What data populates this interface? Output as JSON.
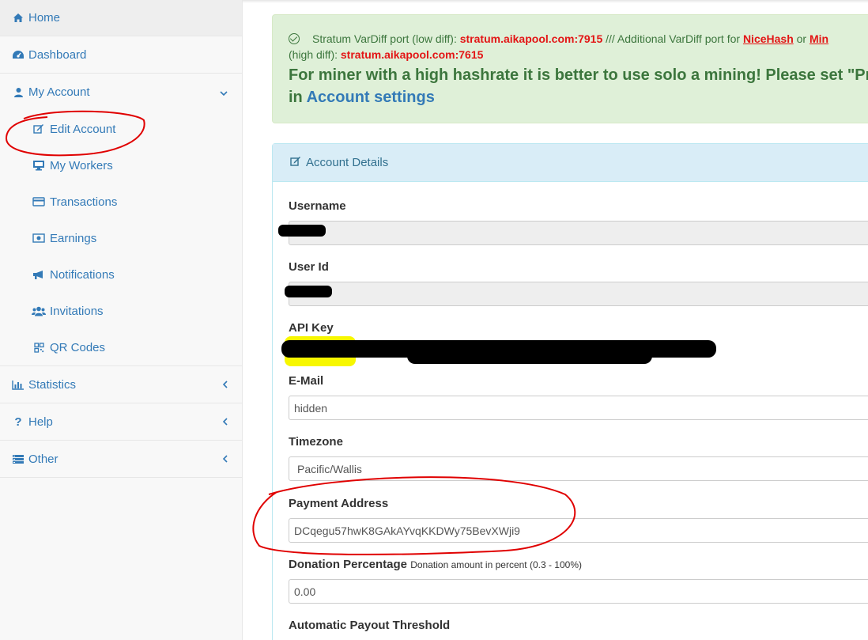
{
  "sidebar": {
    "home": "Home",
    "dashboard": "Dashboard",
    "my_account": "My Account",
    "sub_items": [
      "Edit Account",
      "My Workers",
      "Transactions",
      "Earnings",
      "Notifications",
      "Invitations",
      "QR Codes"
    ],
    "statistics": "Statistics",
    "help": "Help",
    "other": "Other"
  },
  "alert": {
    "text1": "Stratum VarDiff port (low diff): ",
    "port_low": "stratum.aikapool.com:7915",
    "text2": " /// Additional VarDiff port for ",
    "nicehash": "NiceHash",
    "or": " or ",
    "min": "Min",
    "text3": "(high diff): ",
    "port_high": "stratum.aikapool.com:7615",
    "big_text": "For miner with a high hashrate it is better to use solo a mining! Please set \"Pr",
    "big_in": "in ",
    "big_link": "Account settings"
  },
  "panel": {
    "title": "Account Details",
    "username_label": "Username",
    "userid_label": "User Id",
    "apikey_label": "API Key",
    "email_label": "E-Mail",
    "email_value": "hidden",
    "timezone_label": "Timezone",
    "timezone_value": "Pacific/Wallis",
    "payment_label": "Payment Address",
    "payment_value": "DCqegu57hwK8GAkAYvqKKDWy75BevXWji9",
    "donation_label": "Donation Percentage",
    "donation_hint": "Donation amount in percent (0.3 - 100%)",
    "donation_value": "0.00",
    "payout_label": "Automatic Payout Threshold"
  },
  "colors": {
    "link": "#337ab7",
    "alert_green": "#3c763d",
    "alert_bg": "#dff0d8",
    "red": "#e31515",
    "annotation": "#e00000"
  }
}
